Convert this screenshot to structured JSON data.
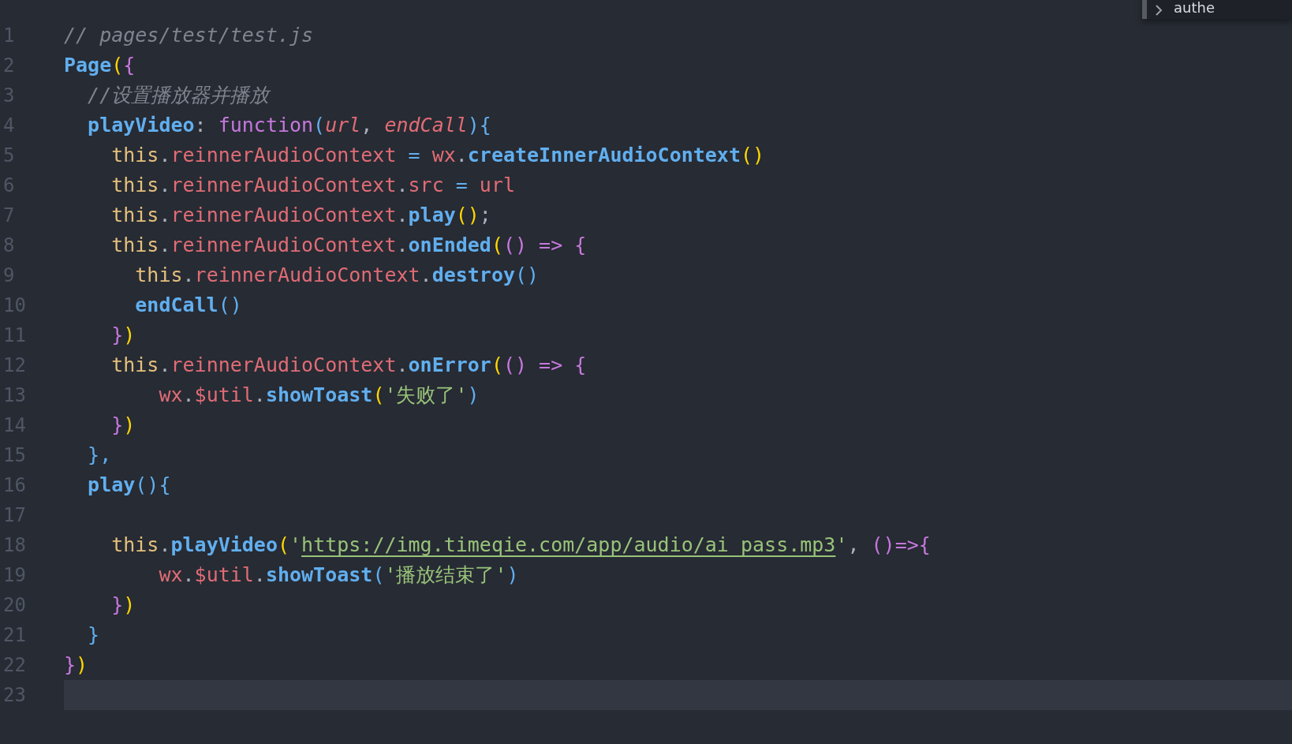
{
  "popup": {
    "text": "authe"
  },
  "lines": [
    {
      "number": "1",
      "current": false,
      "tokens": [
        {
          "kind": "comment",
          "text": "// pages/test/test.js"
        }
      ]
    },
    {
      "number": "2",
      "current": false,
      "tokens": [
        {
          "kind": "method",
          "text": "Page"
        },
        {
          "kind": "paren",
          "text": "("
        },
        {
          "kind": "brace",
          "text": "{"
        }
      ]
    },
    {
      "number": "3",
      "current": false,
      "tokens": [
        {
          "kind": "comment",
          "text": "  //设置播放器并播放"
        }
      ]
    },
    {
      "number": "4",
      "current": false,
      "tokens": [
        {
          "kind": "method",
          "text": "  playVideo"
        },
        {
          "kind": "plain",
          "text": ": "
        },
        {
          "kind": "keyword",
          "text": "function"
        },
        {
          "kind": "op",
          "text": "("
        },
        {
          "kind": "param",
          "text": "url"
        },
        {
          "kind": "plain",
          "text": ", "
        },
        {
          "kind": "param",
          "text": "endCall"
        },
        {
          "kind": "op",
          "text": "){"
        }
      ]
    },
    {
      "number": "5",
      "current": false,
      "tokens": [
        {
          "kind": "this",
          "text": "    this"
        },
        {
          "kind": "plain",
          "text": "."
        },
        {
          "kind": "prop",
          "text": "reinnerAudioContext"
        },
        {
          "kind": "op",
          "text": " = "
        },
        {
          "kind": "prop",
          "text": "wx"
        },
        {
          "kind": "plain",
          "text": "."
        },
        {
          "kind": "method",
          "text": "createInnerAudioContext"
        },
        {
          "kind": "paren",
          "text": "()"
        }
      ]
    },
    {
      "number": "6",
      "current": false,
      "tokens": [
        {
          "kind": "this",
          "text": "    this"
        },
        {
          "kind": "plain",
          "text": "."
        },
        {
          "kind": "prop",
          "text": "reinnerAudioContext"
        },
        {
          "kind": "plain",
          "text": "."
        },
        {
          "kind": "prop",
          "text": "src"
        },
        {
          "kind": "op",
          "text": " = "
        },
        {
          "kind": "prop",
          "text": "url"
        }
      ]
    },
    {
      "number": "7",
      "current": false,
      "tokens": [
        {
          "kind": "this",
          "text": "    this"
        },
        {
          "kind": "plain",
          "text": "."
        },
        {
          "kind": "prop",
          "text": "reinnerAudioContext"
        },
        {
          "kind": "plain",
          "text": "."
        },
        {
          "kind": "method",
          "text": "play"
        },
        {
          "kind": "paren",
          "text": "()"
        },
        {
          "kind": "plain",
          "text": ";"
        }
      ]
    },
    {
      "number": "8",
      "current": false,
      "tokens": [
        {
          "kind": "this",
          "text": "    this"
        },
        {
          "kind": "plain",
          "text": "."
        },
        {
          "kind": "prop",
          "text": "reinnerAudioContext"
        },
        {
          "kind": "plain",
          "text": "."
        },
        {
          "kind": "method",
          "text": "onEnded"
        },
        {
          "kind": "paren",
          "text": "("
        },
        {
          "kind": "brace",
          "text": "() => {"
        }
      ]
    },
    {
      "number": "9",
      "current": false,
      "tokens": [
        {
          "kind": "this",
          "text": "      this"
        },
        {
          "kind": "plain",
          "text": "."
        },
        {
          "kind": "prop",
          "text": "reinnerAudioContext"
        },
        {
          "kind": "plain",
          "text": "."
        },
        {
          "kind": "method",
          "text": "destroy"
        },
        {
          "kind": "op",
          "text": "()"
        }
      ]
    },
    {
      "number": "10",
      "current": false,
      "tokens": [
        {
          "kind": "method",
          "text": "      endCall"
        },
        {
          "kind": "op",
          "text": "()"
        }
      ]
    },
    {
      "number": "11",
      "current": false,
      "tokens": [
        {
          "kind": "brace",
          "text": "    }"
        },
        {
          "kind": "paren",
          "text": ")"
        }
      ]
    },
    {
      "number": "12",
      "current": false,
      "tokens": [
        {
          "kind": "this",
          "text": "    this"
        },
        {
          "kind": "plain",
          "text": "."
        },
        {
          "kind": "prop",
          "text": "reinnerAudioContext"
        },
        {
          "kind": "plain",
          "text": "."
        },
        {
          "kind": "method",
          "text": "onError"
        },
        {
          "kind": "paren",
          "text": "("
        },
        {
          "kind": "brace",
          "text": "() => {"
        }
      ]
    },
    {
      "number": "13",
      "current": false,
      "tokens": [
        {
          "kind": "prop",
          "text": "        wx"
        },
        {
          "kind": "plain",
          "text": "."
        },
        {
          "kind": "prop",
          "text": "$util"
        },
        {
          "kind": "plain",
          "text": "."
        },
        {
          "kind": "method",
          "text": "showToast"
        },
        {
          "kind": "paren",
          "text": "("
        },
        {
          "kind": "string",
          "text": "'失败了'"
        },
        {
          "kind": "op",
          "text": ")"
        }
      ]
    },
    {
      "number": "14",
      "current": false,
      "tokens": [
        {
          "kind": "brace",
          "text": "    }"
        },
        {
          "kind": "paren",
          "text": ")"
        }
      ]
    },
    {
      "number": "15",
      "current": false,
      "tokens": [
        {
          "kind": "op",
          "text": "  },"
        }
      ]
    },
    {
      "number": "16",
      "current": false,
      "tokens": [
        {
          "kind": "method",
          "text": "  play"
        },
        {
          "kind": "op",
          "text": "(){"
        }
      ]
    },
    {
      "number": "17",
      "current": false
    },
    {
      "number": "18",
      "current": false,
      "tokens": [
        {
          "kind": "this",
          "text": "    this"
        },
        {
          "kind": "plain",
          "text": "."
        },
        {
          "kind": "method",
          "text": "playVideo"
        },
        {
          "kind": "paren",
          "text": "("
        },
        {
          "kind": "string",
          "text": "'"
        },
        {
          "kind": "link",
          "text": "https://img.timeqie.com/app/audio/ai_pass.mp3"
        },
        {
          "kind": "string",
          "text": "'"
        },
        {
          "kind": "plain",
          "text": ", "
        },
        {
          "kind": "brace",
          "text": "()=>{"
        }
      ]
    },
    {
      "number": "19",
      "current": false,
      "tokens": [
        {
          "kind": "prop",
          "text": "        wx"
        },
        {
          "kind": "plain",
          "text": "."
        },
        {
          "kind": "prop",
          "text": "$util"
        },
        {
          "kind": "plain",
          "text": "."
        },
        {
          "kind": "method",
          "text": "showToast"
        },
        {
          "kind": "op",
          "text": "("
        },
        {
          "kind": "string",
          "text": "'播放结束了'"
        },
        {
          "kind": "op",
          "text": ")"
        }
      ]
    },
    {
      "number": "20",
      "current": false,
      "tokens": [
        {
          "kind": "brace",
          "text": "    }"
        },
        {
          "kind": "paren",
          "text": ")"
        }
      ]
    },
    {
      "number": "21",
      "current": false,
      "tokens": [
        {
          "kind": "op",
          "text": "  }"
        }
      ]
    },
    {
      "number": "22",
      "current": false,
      "tokens": [
        {
          "kind": "brace",
          "text": "}"
        },
        {
          "kind": "paren",
          "text": ")"
        }
      ]
    },
    {
      "number": "23",
      "current": true
    }
  ]
}
